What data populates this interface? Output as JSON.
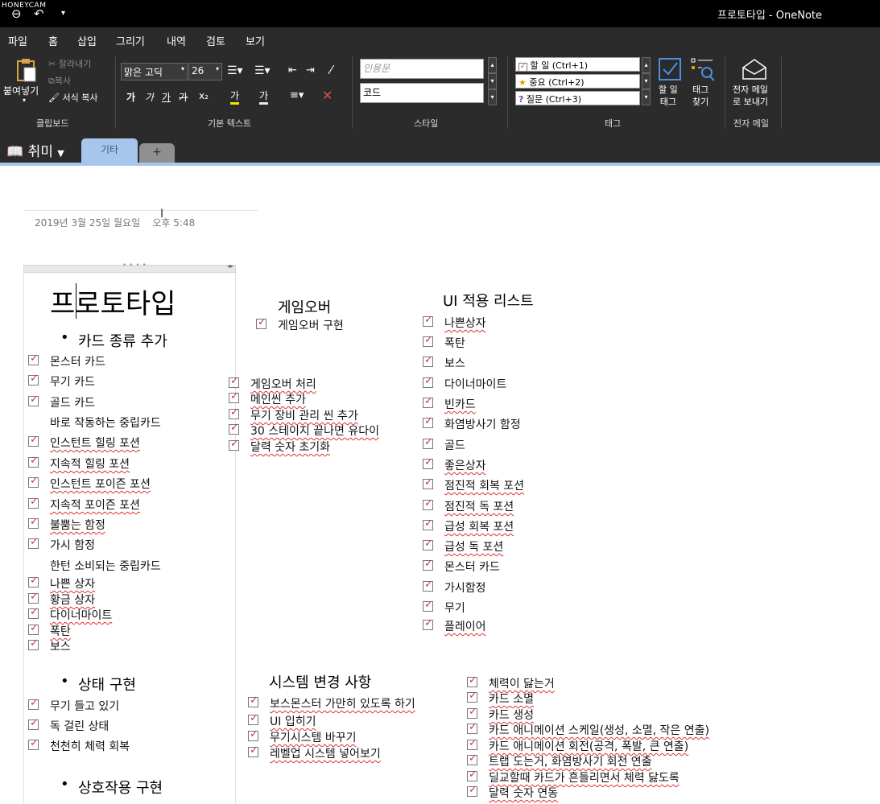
{
  "watermark": "HONEYCAM",
  "window": {
    "title": "프로토타입 - OneNote",
    "qa_back": "⊖",
    "qa_undo": "↶",
    "qa_more": "▾"
  },
  "menu": [
    "파일",
    "홈",
    "삽입",
    "그리기",
    "내역",
    "검토",
    "보기"
  ],
  "ribbon": {
    "clipboard": {
      "paste": "붙여넣기",
      "cut": "잘라내기",
      "copy": "복사",
      "format_painter": "서식 복사",
      "label": "클립보드"
    },
    "basic_text": {
      "font": "맑은 고딕",
      "size": "26",
      "bold": "가",
      "italic": "가",
      "underline": "가",
      "strike": "가",
      "sub": "x₂",
      "highlight": "가",
      "fontcolor": "가",
      "label": "기본 텍스트"
    },
    "styles": {
      "s1": "인용문",
      "s2": "코드",
      "label": "스타일"
    },
    "tags": {
      "t1": "할 일 (Ctrl+1)",
      "t2": "중요 (Ctrl+2)",
      "t3": "질문 (Ctrl+3)",
      "todo_tag": "할 일\n태그",
      "find_tags": "태그\n찾기",
      "label": "태그"
    },
    "email": {
      "send": "전자 메일\n로 보내기",
      "label": "전자 메일"
    }
  },
  "notebook": {
    "name": "취미",
    "section": "기타",
    "add": "+"
  },
  "page": {
    "date": "2019년 3월 25일 월요일",
    "time": "오후 5:48",
    "title": "프로토타입"
  },
  "sections": {
    "cards": {
      "heading": "카드 종류 추가",
      "items_a": [
        "몬스터 카드",
        "무기 카드",
        "골드 카드"
      ],
      "sub1": "바로 작동하는 중립카드",
      "items_b": [
        "인스턴트 힐링 포션",
        "지속적 힐링 포션",
        "인스턴트 포이즌 포션",
        "지속적 포이즌 포션",
        "불뿜는 함정",
        "가시 함정"
      ],
      "sub2": "한턴 소비되는 중립카드",
      "items_c": [
        "나쁜 상자",
        "황금 상자",
        "다이너마이트",
        "폭탄",
        "보스"
      ]
    },
    "state": {
      "heading": "상태 구현",
      "items": [
        "무기 들고 있기",
        "독 걸린 상태",
        "천천히 체력 회복"
      ]
    },
    "interaction": {
      "heading": "상호작용 구현"
    },
    "gameover": {
      "heading": "게임오버",
      "items": [
        "게임오버 구현"
      ]
    },
    "middle": {
      "items": [
        "게임오버 처리",
        "메인씬 추가",
        "무기 장비 관리 씬 추가",
        "30 스테이지 끝나면 유다이",
        "달력 숫자 초기화"
      ]
    },
    "ui": {
      "heading": "UI 적용 리스트",
      "items": [
        "나쁜상자",
        "폭탄",
        "보스",
        "다이너마이트",
        "빈카드",
        "화염방사기 함정",
        "골드",
        "좋은상자",
        "점진적 회복 포션",
        "점진적 독 포션",
        "급성 회복 포션",
        "급성 독 포션",
        "몬스터 카드",
        "가시함정",
        "무기",
        "플레이어"
      ]
    },
    "system": {
      "heading": "시스템 변경 사항",
      "items": [
        "보스몬스터 가만히 있도록 하기",
        "UI 입히기",
        "무기시스템 바꾸기",
        "레벨업 시스템 넣어보기"
      ]
    },
    "right": {
      "items": [
        "체력이 닳는거",
        "카드 소멸",
        "카드 생성",
        "카드 애니메이션 스케일(생성, 소멸, 작은 연출)",
        "카드 애니메이션 회전(공격, 폭발, 큰 연출)",
        "트랩 도는거, 화염방사기 회전 연출",
        "딜교할때 카드가 흔들리면서 체력 닳도록",
        "달력 숫자 연동"
      ]
    }
  }
}
